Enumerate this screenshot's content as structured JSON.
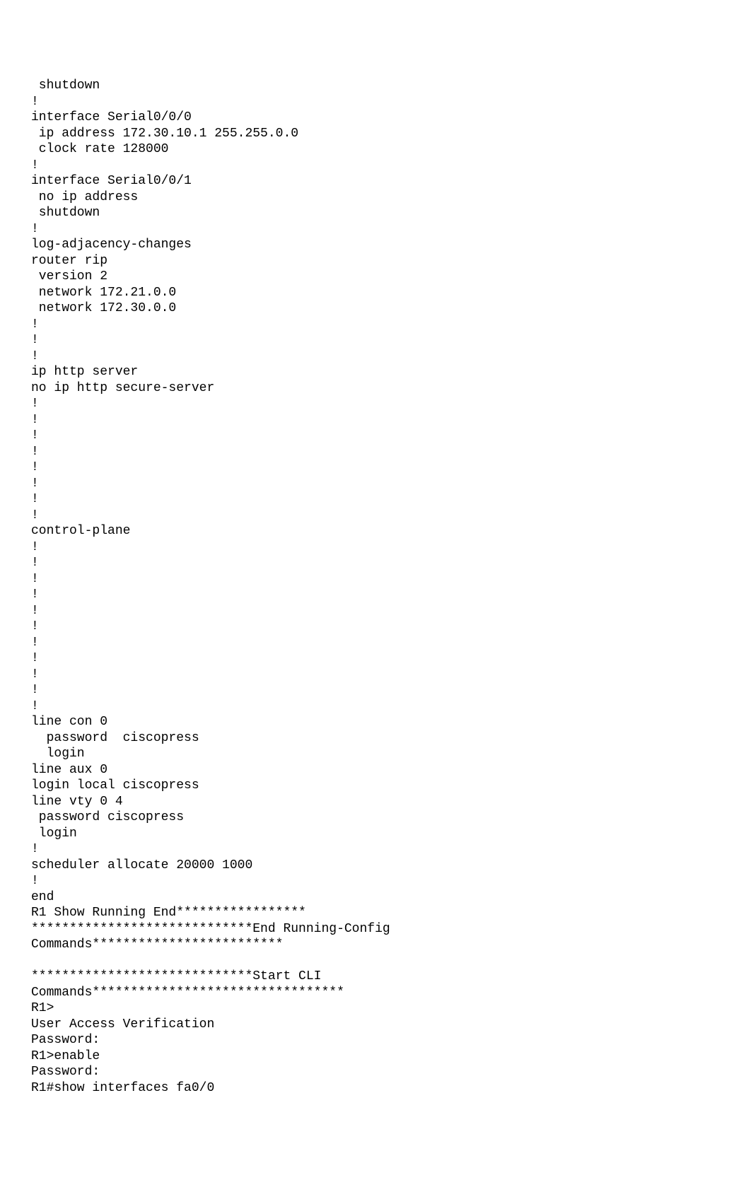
{
  "config_text": " shutdown\n!\ninterface Serial0/0/0\n ip address 172.30.10.1 255.255.0.0\n clock rate 128000\n!\ninterface Serial0/0/1\n no ip address\n shutdown\n!\nlog-adjacency-changes\nrouter rip\n version 2\n network 172.21.0.0\n network 172.30.0.0\n!\n!\n!\nip http server\nno ip http secure-server\n!\n!\n!\n!\n!\n!\n!\n!\ncontrol-plane\n!\n!\n!\n!\n!\n!\n!\n!\n!\n!\n!\nline con 0\n  password  ciscopress\n  login\nline aux 0\nlogin local ciscopress\nline vty 0 4\n password ciscopress\n login\n!\nscheduler allocate 20000 1000\n!\nend\nR1 Show Running End*****************\n*****************************End Running-Config\nCommands*************************\n\n*****************************Start CLI\nCommands*********************************\nR1>\nUser Access Verification\nPassword:\nR1>enable\nPassword:\nR1#show interfaces fa0/0"
}
